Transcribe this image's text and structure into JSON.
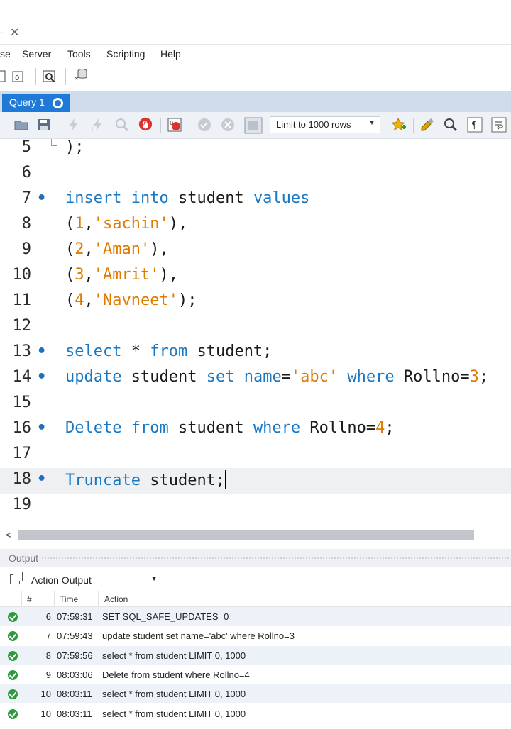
{
  "window": {
    "minimize_glyph": "-",
    "close_glyph": "✕"
  },
  "menu": [
    "se",
    "Server",
    "Tools",
    "Scripting",
    "Help"
  ],
  "tab": {
    "label": "Query 1"
  },
  "editor_toolbar": {
    "limit_label": "Limit to 1000 rows"
  },
  "editor": {
    "lines": [
      {
        "n": "5",
        "dot": false,
        "tokens": [
          [
            "p",
            ");"
          ]
        ]
      },
      {
        "n": "6",
        "dot": false,
        "tokens": []
      },
      {
        "n": "7",
        "dot": true,
        "tokens": [
          [
            "kw",
            "insert"
          ],
          [
            "p",
            " "
          ],
          [
            "kw",
            "into"
          ],
          [
            "p",
            " student "
          ],
          [
            "kw",
            "values"
          ]
        ]
      },
      {
        "n": "8",
        "dot": false,
        "tokens": [
          [
            "p",
            "("
          ],
          [
            "num",
            "1"
          ],
          [
            "p",
            ","
          ],
          [
            "str",
            "'sachin'"
          ],
          [
            "p",
            "),"
          ]
        ]
      },
      {
        "n": "9",
        "dot": false,
        "tokens": [
          [
            "p",
            "("
          ],
          [
            "num",
            "2"
          ],
          [
            "p",
            ","
          ],
          [
            "str",
            "'Aman'"
          ],
          [
            "p",
            "),"
          ]
        ]
      },
      {
        "n": "10",
        "dot": false,
        "tokens": [
          [
            "p",
            "("
          ],
          [
            "num",
            "3"
          ],
          [
            "p",
            ","
          ],
          [
            "str",
            "'Amrit'"
          ],
          [
            "p",
            "),"
          ]
        ]
      },
      {
        "n": "11",
        "dot": false,
        "tokens": [
          [
            "p",
            "("
          ],
          [
            "num",
            "4"
          ],
          [
            "p",
            ","
          ],
          [
            "str",
            "'Navneet'"
          ],
          [
            "p",
            ");"
          ]
        ]
      },
      {
        "n": "12",
        "dot": false,
        "tokens": []
      },
      {
        "n": "13",
        "dot": true,
        "tokens": [
          [
            "kw",
            "select"
          ],
          [
            "p",
            " * "
          ],
          [
            "kw",
            "from"
          ],
          [
            "p",
            " student;"
          ]
        ]
      },
      {
        "n": "14",
        "dot": true,
        "tokens": [
          [
            "kw",
            "update"
          ],
          [
            "p",
            " student "
          ],
          [
            "kw",
            "set"
          ],
          [
            "p",
            " "
          ],
          [
            "kw",
            "name"
          ],
          [
            "p",
            "="
          ],
          [
            "str",
            "'abc'"
          ],
          [
            "p",
            " "
          ],
          [
            "kw",
            "where"
          ],
          [
            "p",
            " Rollno="
          ],
          [
            "num",
            "3"
          ],
          [
            "p",
            ";"
          ]
        ]
      },
      {
        "n": "15",
        "dot": false,
        "tokens": []
      },
      {
        "n": "16",
        "dot": true,
        "tokens": [
          [
            "kw",
            "Delete"
          ],
          [
            "p",
            " "
          ],
          [
            "kw",
            "from"
          ],
          [
            "p",
            " student "
          ],
          [
            "kw",
            "where"
          ],
          [
            "p",
            " Rollno="
          ],
          [
            "num",
            "4"
          ],
          [
            "p",
            ";"
          ]
        ]
      },
      {
        "n": "17",
        "dot": false,
        "tokens": []
      },
      {
        "n": "18",
        "dot": true,
        "current": true,
        "tokens": [
          [
            "kw",
            "Truncate"
          ],
          [
            "p",
            " student;"
          ]
        ]
      },
      {
        "n": "19",
        "dot": false,
        "tokens": []
      }
    ]
  },
  "output": {
    "header": "Output",
    "selector_value": "Action Output",
    "columns": [
      "#",
      "Time",
      "Action"
    ],
    "rows": [
      {
        "n": "6",
        "time": "07:59:31",
        "action": "SET SQL_SAFE_UPDATES=0"
      },
      {
        "n": "7",
        "time": "07:59:43",
        "action": "update student set name='abc' where Rollno=3"
      },
      {
        "n": "8",
        "time": "07:59:56",
        "action": "select * from student LIMIT 0, 1000"
      },
      {
        "n": "9",
        "time": "08:03:06",
        "action": "Delete from student where Rollno=4"
      },
      {
        "n": "10",
        "time": "08:03:11",
        "action": "select * from student LIMIT 0, 1000"
      },
      {
        "n": "10",
        "time": "08:03:11",
        "action": "select * from student LIMIT 0, 1000"
      }
    ],
    "status_icon": "success-check-icon"
  },
  "colors": {
    "keyword": "#1a78c2",
    "literal": "#e07b00",
    "tab_active": "#1e7ad6",
    "success": "#2e9a3c"
  }
}
